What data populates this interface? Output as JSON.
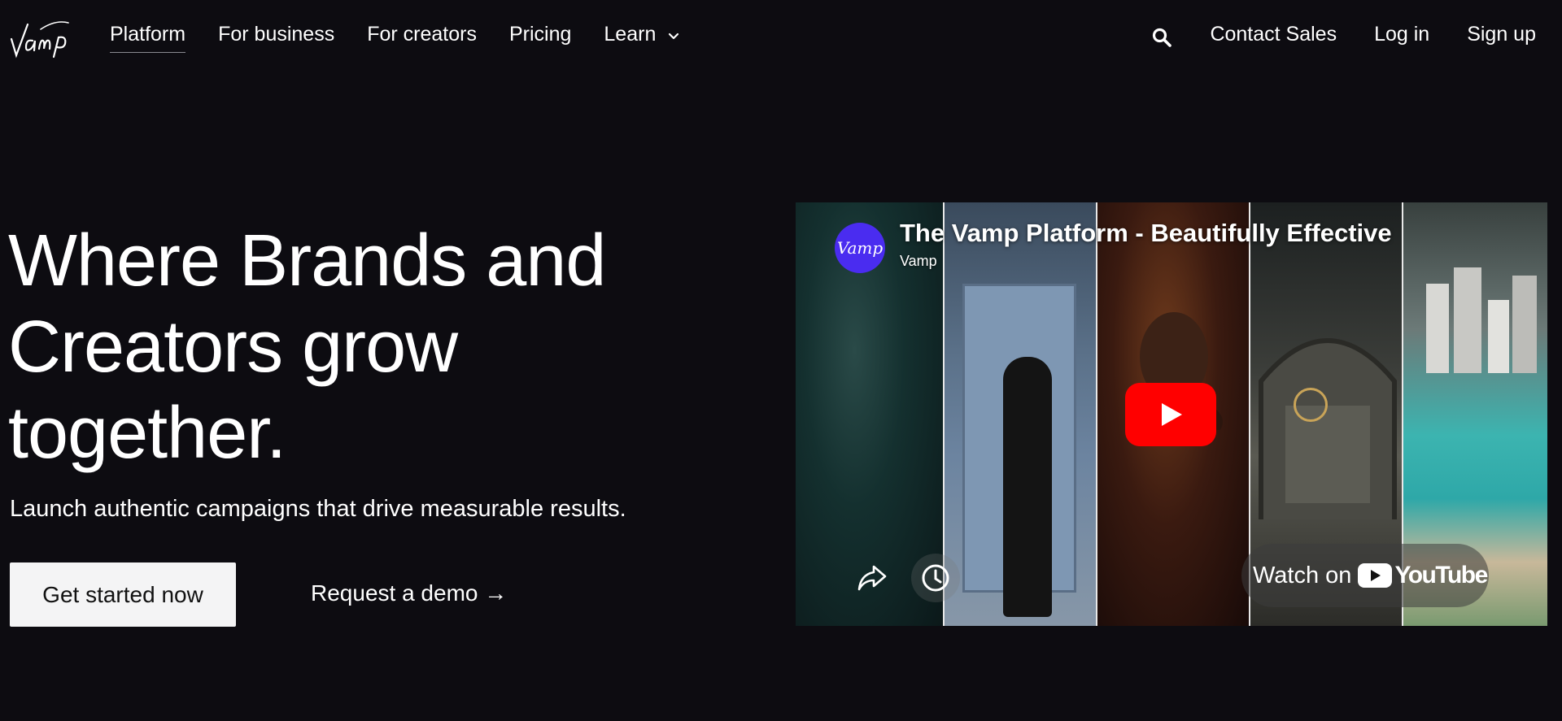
{
  "nav": {
    "logo_text": "Vamp",
    "links": [
      {
        "label": "Platform",
        "active": true
      },
      {
        "label": "For business"
      },
      {
        "label": "For creators"
      },
      {
        "label": "Pricing"
      },
      {
        "label": "Learn"
      }
    ],
    "search_icon": "search-icon",
    "contact_sales": "Contact Sales",
    "log_in": "Log in",
    "sign_up": "Sign up"
  },
  "hero": {
    "title_lines": [
      "Where Brands and",
      "Creators grow",
      "together."
    ],
    "subtitle": "Launch authentic campaigns that drive measurable results.",
    "primary_cta": "Get started now",
    "secondary_cta": "Request a demo →"
  },
  "video": {
    "avatar_text": "Vamp",
    "title": "The Vamp Platform - Beautifully Effective",
    "channel": "Vamp",
    "watch_on": "Watch on",
    "youtube_word": "YouTube",
    "colors": {
      "play_red": "#ff0000",
      "avatar_purple": "#4a2cf0"
    }
  },
  "colors": {
    "background": "#0d0c11",
    "text": "#ffffff",
    "button_bg": "#f4f4f5"
  }
}
